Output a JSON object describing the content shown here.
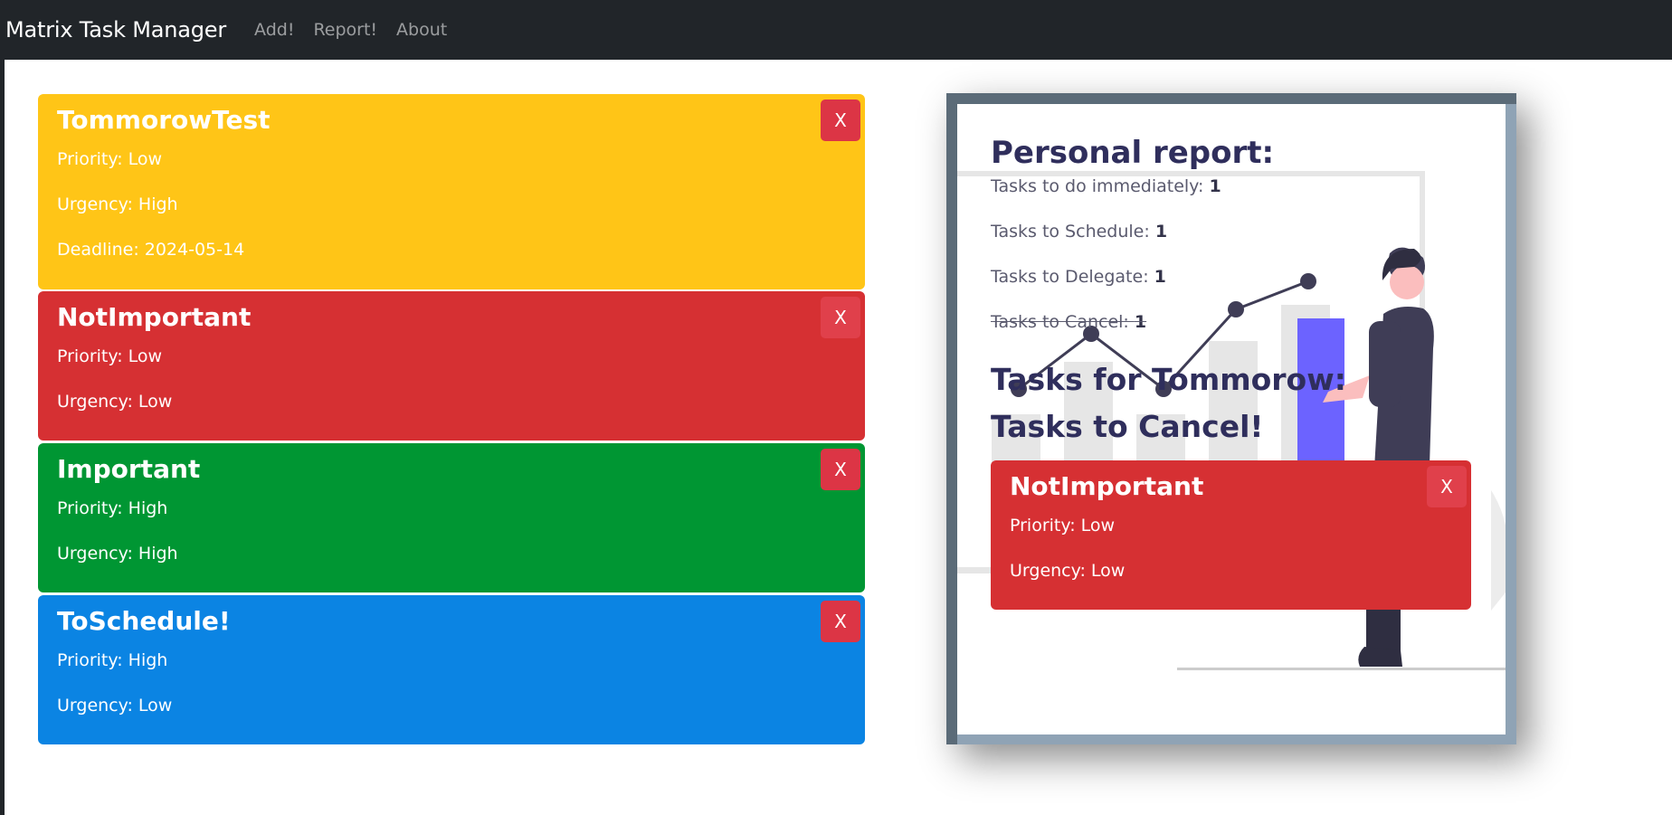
{
  "navbar": {
    "brand": "Matrix Task Manager",
    "links": [
      "Add!",
      "Report!",
      "About"
    ]
  },
  "tasks": [
    {
      "title": "TommorowTest",
      "priority": "Priority: Low",
      "urgency": "Urgency: High",
      "deadline": "Deadline: 2024-05-14",
      "close": "X",
      "color": "#ffc517"
    },
    {
      "title": "NotImportant",
      "priority": "Priority: Low",
      "urgency": "Urgency: Low",
      "close": "X",
      "color": "#d63033"
    },
    {
      "title": "Important",
      "priority": "Priority: High",
      "urgency": "Urgency: High",
      "close": "X",
      "color": "#009633"
    },
    {
      "title": "ToSchedule!",
      "priority": "Priority: High",
      "urgency": "Urgency: Low",
      "close": "X",
      "color": "#0b84e3"
    }
  ],
  "report": {
    "title": "Personal report:",
    "stats": [
      {
        "label": "Tasks to do immediately: ",
        "count": "1"
      },
      {
        "label": "Tasks to Schedule: ",
        "count": "1"
      },
      {
        "label": "Tasks to Delegate: ",
        "count": "1"
      },
      {
        "label": "Tasks to Cancel: ",
        "count": "1"
      }
    ],
    "tomorrow_heading": "Tasks for Tommorow:",
    "cancel_heading": "Tasks to Cancel!",
    "cancel_task": {
      "title": "NotImportant",
      "priority": "Priority: Low",
      "urgency": "Urgency: Low",
      "close": "X",
      "color": "#d63033"
    }
  }
}
